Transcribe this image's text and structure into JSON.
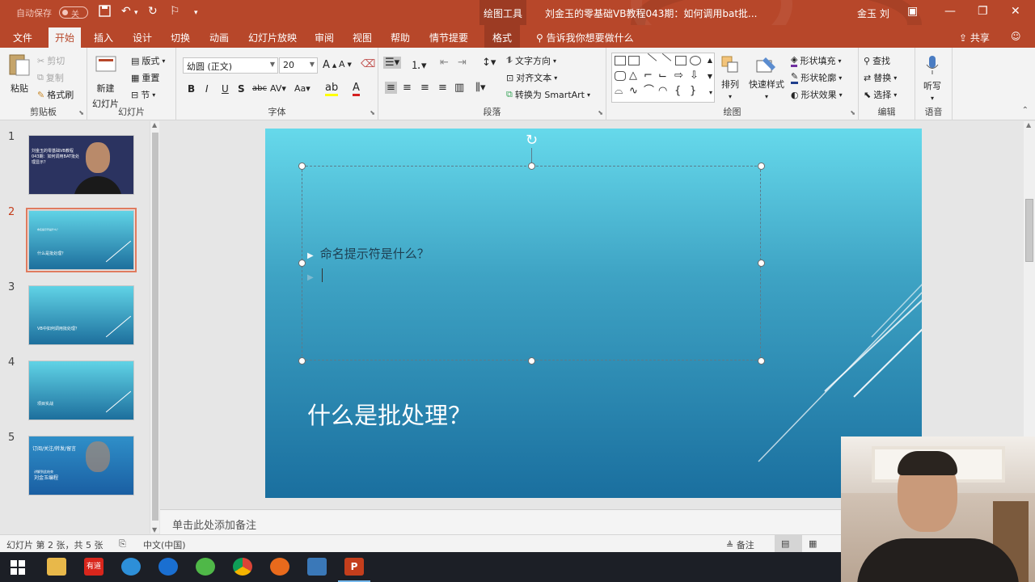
{
  "titlebar": {
    "autosave_label": "自动保存",
    "autosave_state": "关",
    "context_tools": "绘图工具",
    "document_title": "刘金玉的零基础VB教程043期：如何调用bat批...",
    "user_name": "金玉 刘"
  },
  "tabs": [
    {
      "label": "文件"
    },
    {
      "label": "开始"
    },
    {
      "label": "插入"
    },
    {
      "label": "设计"
    },
    {
      "label": "切换"
    },
    {
      "label": "动画"
    },
    {
      "label": "幻灯片放映"
    },
    {
      "label": "审阅"
    },
    {
      "label": "视图"
    },
    {
      "label": "帮助"
    },
    {
      "label": "情节提要"
    },
    {
      "label": "格式"
    }
  ],
  "tell_me": "告诉我你想要做什么",
  "share": "共享",
  "ribbon": {
    "clipboard": {
      "label": "剪贴板",
      "paste": "粘贴",
      "cut": "剪切",
      "copy": "复制",
      "format_painter": "格式刷"
    },
    "slides": {
      "label": "幻灯片",
      "new_slide": "新建",
      "new_slide2": "幻灯片",
      "layout": "版式",
      "reset": "重置",
      "section": "节"
    },
    "font": {
      "label": "字体",
      "font_name": "幼圆 (正文)",
      "font_size": "20"
    },
    "paragraph": {
      "label": "段落",
      "text_direction": "文字方向",
      "align_text": "对齐文本",
      "smartart": "转换为 SmartArt"
    },
    "drawing": {
      "label": "绘图",
      "arrange": "排列",
      "quick_styles": "快速样式",
      "shape_fill": "形状填充",
      "shape_outline": "形状轮廓",
      "shape_effects": "形状效果"
    },
    "editing": {
      "label": "编辑",
      "find": "查找",
      "replace": "替换",
      "select": "选择"
    },
    "voice": {
      "label": "语音",
      "dictate": "听写"
    }
  },
  "thumbnails": [
    {
      "number": "1",
      "text": "刘金玉的零基础VB教程043期：如何调用BAT批处理显示？"
    },
    {
      "number": "2",
      "text": "什么是批处理？",
      "subtext": "命名提示符是什么？"
    },
    {
      "number": "3",
      "text": "VB中如何调用批处理？"
    },
    {
      "number": "4",
      "text": "项目实战"
    },
    {
      "number": "5",
      "text": "订阅/关注/转发/留言",
      "subtext": "讲解到此结束",
      "author": "刘金玉编程"
    }
  ],
  "slide": {
    "bullet1": "命名提示符是什么？",
    "title": "什么是批处理？"
  },
  "notes_placeholder": "单击此处添加备注",
  "status": {
    "slide_info": "幻灯片 第 2 张，共 5 张",
    "language": "中文(中国)",
    "notes": "备注"
  },
  "colors": {
    "accent": "#b7472a",
    "context_tab": "#9c3b23",
    "slide_top": "#66d9eb",
    "slide_bottom": "#1a6f9f"
  }
}
